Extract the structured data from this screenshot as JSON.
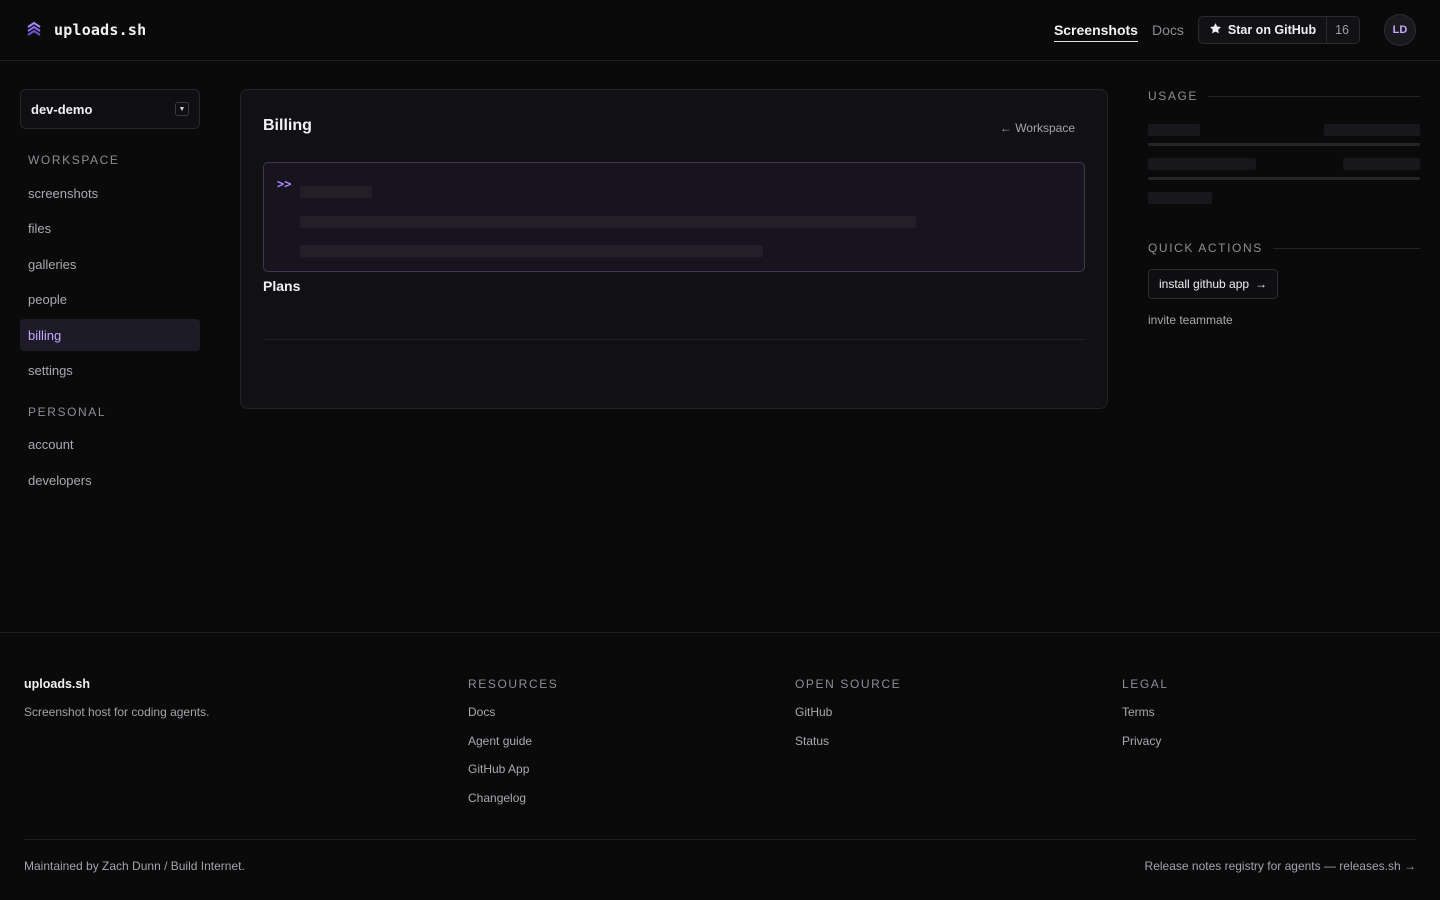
{
  "header": {
    "brand": "uploads.sh",
    "nav": [
      {
        "label": "Screenshots",
        "active": true
      },
      {
        "label": "Docs",
        "active": false
      }
    ],
    "github": {
      "label": "Star on GitHub",
      "count": "16"
    },
    "avatar_initials": "LD"
  },
  "sidebar": {
    "workspace_select": "dev-demo",
    "sections": [
      {
        "title": "WORKSPACE",
        "items": [
          {
            "label": "screenshots",
            "active": false
          },
          {
            "label": "files",
            "active": false
          },
          {
            "label": "galleries",
            "active": false
          },
          {
            "label": "people",
            "active": false
          },
          {
            "label": "billing",
            "active": true
          },
          {
            "label": "settings",
            "active": false
          }
        ]
      },
      {
        "title": "PERSONAL",
        "items": [
          {
            "label": "account",
            "active": false
          },
          {
            "label": "developers",
            "active": false
          }
        ]
      }
    ]
  },
  "main": {
    "title": "Billing",
    "back_link": "← Workspace",
    "plan_box_icon": ">>",
    "plans_label": "Plans"
  },
  "right_panel": {
    "usage_title": "USAGE",
    "quick_actions_title": "QUICK ACTIONS",
    "install_button": "install github app",
    "install_arrow": "→",
    "invite_link": "invite teammate"
  },
  "footer": {
    "brand": "uploads.sh",
    "tagline": "Screenshot host for coding agents.",
    "columns": [
      {
        "title": "RESOURCES",
        "links": [
          "Docs",
          "Agent guide",
          "GitHub App",
          "Changelog"
        ]
      },
      {
        "title": "OPEN SOURCE",
        "links": [
          "GitHub",
          "Status"
        ]
      },
      {
        "title": "LEGAL",
        "links": [
          "Terms",
          "Privacy"
        ]
      }
    ],
    "maintained": "Maintained by Zach Dunn / Build Internet.",
    "releases": "Release notes registry for agents — releases.sh →"
  },
  "colors": {
    "background": "#0a0a0b",
    "accent": "#c7a6ff",
    "active_bg": "#1e1b29"
  }
}
